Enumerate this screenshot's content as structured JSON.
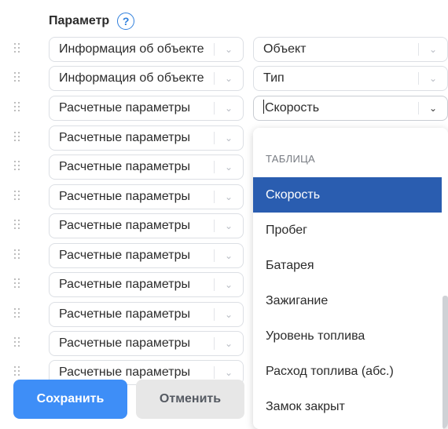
{
  "header": {
    "title": "Параметр",
    "help_icon": "?"
  },
  "rows": [
    {
      "left": "Информация об объекте",
      "right": "Объект"
    },
    {
      "left": "Информация об объекте",
      "right": "Тип"
    },
    {
      "left": "Расчетные параметры",
      "right": "Скорость"
    },
    {
      "left": "Расчетные параметры"
    },
    {
      "left": "Расчетные параметры"
    },
    {
      "left": "Расчетные параметры"
    },
    {
      "left": "Расчетные параметры"
    },
    {
      "left": "Расчетные параметры"
    },
    {
      "left": "Расчетные параметры"
    },
    {
      "left": "Расчетные параметры"
    },
    {
      "left": "Расчетные параметры"
    },
    {
      "left": "Расчетные параметры"
    }
  ],
  "dropdown": {
    "group_label": "ТАБЛИЦА",
    "items": [
      "Скорость",
      "Пробег",
      "Батарея",
      "Зажигание",
      "Уровень топлива",
      "Расход топлива (абс.)",
      "Замок закрыт"
    ],
    "selected": "Скорость"
  },
  "buttons": {
    "save": "Сохранить",
    "cancel": "Отменить"
  },
  "icons": {
    "drag": "drag-handle-icon",
    "chevron": "chevron-down-icon",
    "help": "help-circle-icon"
  },
  "colors": {
    "primary": "#3e8ef7",
    "selected_bg": "#2a5db0",
    "help": "#2f7fdc"
  }
}
